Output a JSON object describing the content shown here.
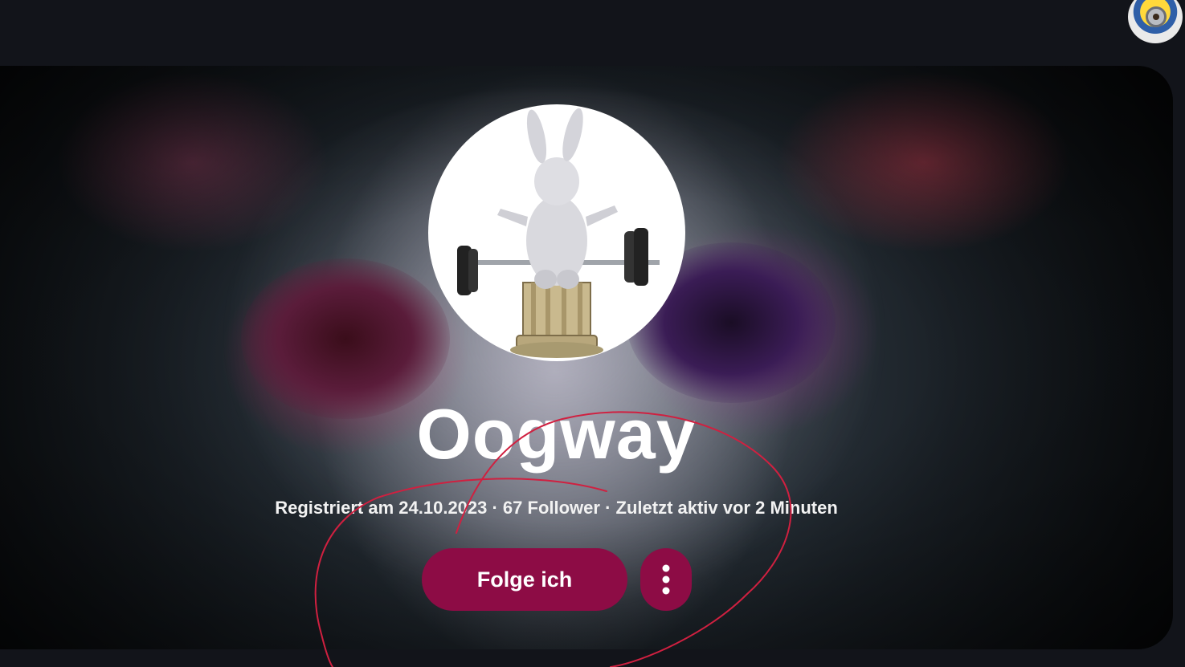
{
  "header": {
    "user_avatar_icon": "minion-avatar-icon"
  },
  "profile": {
    "avatar_icon": "rabbid-weightlifter-avatar-icon",
    "banner_image": "skull-banner-image",
    "username": "Oogway",
    "meta_text": "Registriert am 24.10.2023 · 67 Follower · Zuletzt aktiv vor 2 Minuten",
    "registered_date": "24.10.2023",
    "follower_count": 67,
    "last_active": "vor 2 Minuten"
  },
  "actions": {
    "follow_label": "Folge ich",
    "more_icon": "more-vertical-icon"
  },
  "colors": {
    "background": "#12141a",
    "accent": "#8d0c45",
    "annotation": "#d02040"
  }
}
